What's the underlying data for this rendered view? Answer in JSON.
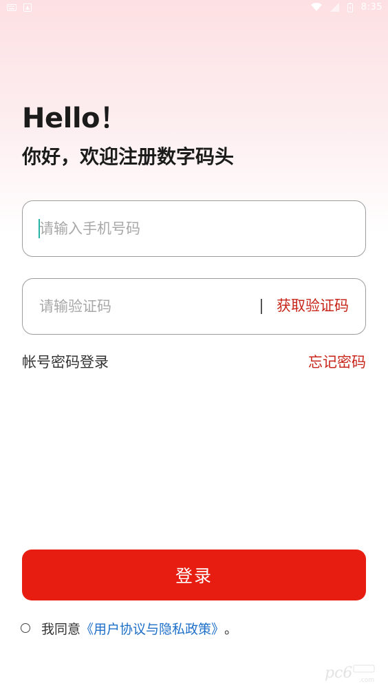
{
  "status_bar": {
    "time": "8:35"
  },
  "header": {
    "greeting": "Hello！",
    "subtitle": "你好，欢迎注册数字码头"
  },
  "form": {
    "phone_placeholder": "请输入手机号码",
    "code_placeholder": "请输验证码",
    "get_code_label": "获取验证码"
  },
  "links": {
    "password_login": "帐号密码登录",
    "forgot_password": "忘记密码"
  },
  "login_button": "登录",
  "agreement": {
    "prefix": "我同意",
    "policy_link": "《用户协议与隐私政策》",
    "suffix": "。"
  },
  "colors": {
    "accent_red": "#e61d10",
    "link_red": "#c8261b",
    "link_blue": "#1d6fc9"
  }
}
